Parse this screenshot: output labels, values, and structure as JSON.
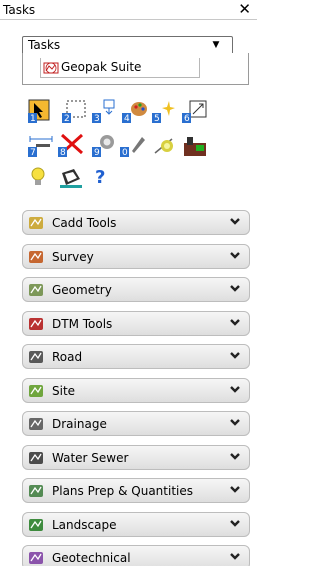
{
  "window": {
    "title": "Tasks",
    "close_glyph": "✕"
  },
  "task_selector": {
    "value": "Tasks",
    "dropdown_glyph": "▼"
  },
  "tree": {
    "item_label": "Geopak Suite",
    "item_icon": "geopak-suite-icon"
  },
  "tools": [
    {
      "name": "select-element-tool",
      "number": "1"
    },
    {
      "name": "place-fence-tool",
      "number": "2"
    },
    {
      "name": "manipulate-tool",
      "number": "3"
    },
    {
      "name": "change-attributes-tool",
      "number": "4"
    },
    {
      "name": "delete-part-tool",
      "number": "5"
    },
    {
      "name": "measure-tool",
      "number": "6"
    },
    {
      "name": "dimension-tool",
      "number": "7"
    },
    {
      "name": "delete-element-tool",
      "number": "8"
    },
    {
      "name": "analyze-element-tool",
      "number": "9"
    },
    {
      "name": "drop-element-tool",
      "number": "0"
    },
    {
      "name": "display-settings-tool",
      "number": ""
    },
    {
      "name": "tool-settings-tool",
      "number": ""
    },
    {
      "name": "hint-bulb-tool",
      "number": ""
    },
    {
      "name": "save-tool",
      "number": ""
    },
    {
      "name": "help-tool",
      "number": ""
    }
  ],
  "categories": [
    {
      "label": "Cadd Tools",
      "icon": "cadd-tools-icon",
      "accent": "#c8a020"
    },
    {
      "label": "Survey",
      "icon": "survey-icon",
      "accent": "#c05010"
    },
    {
      "label": "Geometry",
      "icon": "geometry-icon",
      "accent": "#6a8a40"
    },
    {
      "label": "DTM Tools",
      "icon": "dtm-tools-icon",
      "accent": "#b01010"
    },
    {
      "label": "Road",
      "icon": "road-icon",
      "accent": "#404040"
    },
    {
      "label": "Site",
      "icon": "site-icon",
      "accent": "#5a9a20"
    },
    {
      "label": "Drainage",
      "icon": "drainage-icon",
      "accent": "#505050"
    },
    {
      "label": "Water Sewer",
      "icon": "water-sewer-icon",
      "accent": "#303030"
    },
    {
      "label": "Plans Prep & Quantities",
      "icon": "plans-prep-icon",
      "accent": "#3a7a3a"
    },
    {
      "label": "Landscape",
      "icon": "landscape-icon",
      "accent": "#207a20"
    },
    {
      "label": "Geotechnical",
      "icon": "geotechnical-icon",
      "accent": "#7a3aa0"
    }
  ]
}
